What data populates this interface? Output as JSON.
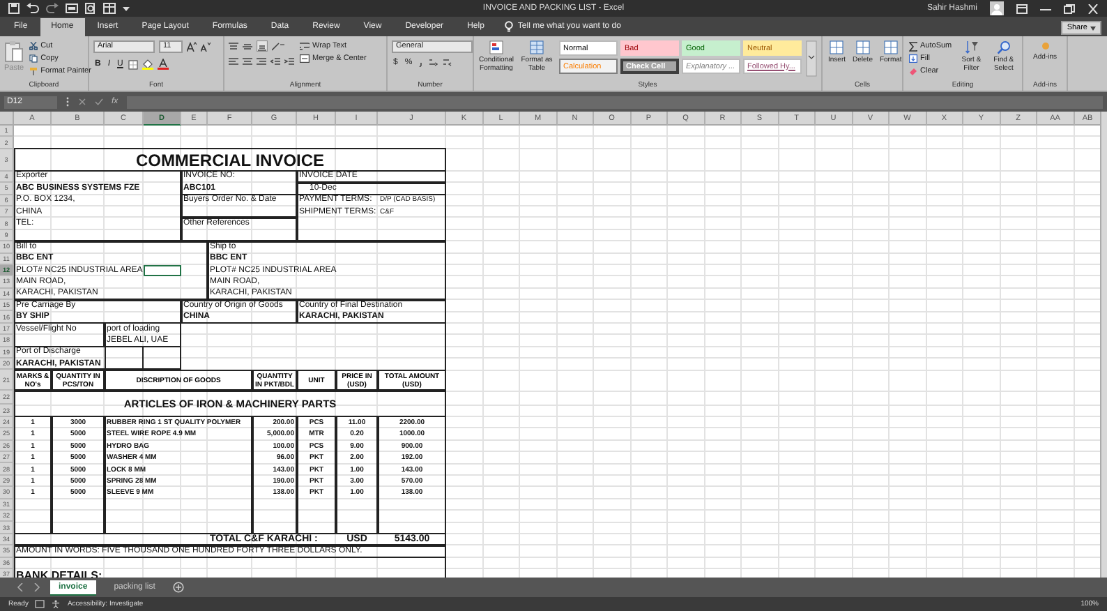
{
  "window": {
    "title": "INVOICE AND PACKING LIST - Excel",
    "user": "Sahir Hashmi"
  },
  "tabs": [
    {
      "label": "File",
      "selected": false
    },
    {
      "label": "Home",
      "selected": true
    },
    {
      "label": "Insert",
      "selected": false
    },
    {
      "label": "Page Layout",
      "selected": false
    },
    {
      "label": "Formulas",
      "selected": false
    },
    {
      "label": "Data",
      "selected": false
    },
    {
      "label": "Review",
      "selected": false
    },
    {
      "label": "View",
      "selected": false
    },
    {
      "label": "Developer",
      "selected": false
    },
    {
      "label": "Help",
      "selected": false
    }
  ],
  "tell_me": {
    "placeholder": "Tell me what you want to do"
  },
  "share": "Share",
  "ribbon": {
    "clipboard": {
      "label": "Clipboard",
      "paste": "Paste",
      "cut": "Cut",
      "copy": "Copy",
      "format_painter": "Format Painter"
    },
    "font": {
      "label": "Font",
      "family": "Arial",
      "size": "11",
      "style_buttons": [
        "B",
        "I",
        "U"
      ]
    },
    "alignment": {
      "label": "Alignment",
      "wrap_text": "Wrap Text",
      "merge_center": "Merge & Center"
    },
    "number": {
      "label": "Number",
      "format": "General",
      "buttons": [
        "$",
        "%"
      ]
    },
    "styles": {
      "label": "Styles",
      "conditional_formatting": "Conditional Formatting",
      "format_as_table": "Format as Table",
      "cell_styles": [
        {
          "label": "Normal",
          "kind": "normal"
        },
        {
          "label": "Bad",
          "kind": "bad"
        },
        {
          "label": "Good",
          "kind": "good"
        },
        {
          "label": "Neutral",
          "kind": "neutral"
        },
        {
          "label": "Calculation",
          "kind": "calculation"
        },
        {
          "label": "Check Cell",
          "kind": "check"
        },
        {
          "label": "Explanatory ...",
          "kind": "explanatory"
        },
        {
          "label": "Followed Hy...",
          "kind": "followed_link"
        }
      ]
    },
    "cells": {
      "label": "Cells",
      "buttons": [
        "Insert",
        "Delete",
        "Format"
      ]
    },
    "editing": {
      "label": "Editing",
      "autosum": "AutoSum",
      "fill": "Fill",
      "clear": "Clear",
      "sort_filter": "Sort & Filter",
      "find_select": "Find & Select"
    },
    "addins": {
      "label": "Add-ins",
      "button": "Add-ins"
    }
  },
  "formula_bar": {
    "name_box": "D12",
    "function_label": "fx"
  },
  "sheet": {
    "columns": [
      {
        "label": "A",
        "selected": false
      },
      {
        "label": "B",
        "selected": false
      },
      {
        "label": "C",
        "selected": false
      },
      {
        "label": "D",
        "selected": true
      },
      {
        "label": "E",
        "selected": false
      },
      {
        "label": "F",
        "selected": false
      },
      {
        "label": "G",
        "selected": false
      },
      {
        "label": "H",
        "selected": false
      },
      {
        "label": "I",
        "selected": false
      },
      {
        "label": "J",
        "selected": false
      },
      {
        "label": "K",
        "selected": false
      },
      {
        "label": "L",
        "selected": false
      },
      {
        "label": "M",
        "selected": false
      },
      {
        "label": "N",
        "selected": false
      },
      {
        "label": "O",
        "selected": false
      },
      {
        "label": "P",
        "selected": false
      },
      {
        "label": "Q",
        "selected": false
      },
      {
        "label": "R",
        "selected": false
      },
      {
        "label": "S",
        "selected": false
      },
      {
        "label": "T",
        "selected": false
      },
      {
        "label": "U",
        "selected": false
      },
      {
        "label": "V",
        "selected": false
      },
      {
        "label": "W",
        "selected": false
      },
      {
        "label": "X",
        "selected": false
      },
      {
        "label": "Y",
        "selected": false
      },
      {
        "label": "Z",
        "selected": false
      },
      {
        "label": "AA",
        "selected": false
      },
      {
        "label": "AB",
        "selected": false
      }
    ],
    "rows": [
      {
        "label": "1",
        "selected": false
      },
      {
        "label": "2",
        "selected": false
      },
      {
        "label": "3",
        "selected": false
      },
      {
        "label": "4",
        "selected": false
      },
      {
        "label": "5",
        "selected": false
      },
      {
        "label": "6",
        "selected": false
      },
      {
        "label": "7",
        "selected": false
      },
      {
        "label": "8",
        "selected": false
      },
      {
        "label": "9",
        "selected": false
      },
      {
        "label": "10",
        "selected": false
      },
      {
        "label": "11",
        "selected": false
      },
      {
        "label": "12",
        "selected": true
      },
      {
        "label": "13",
        "selected": false
      },
      {
        "label": "14",
        "selected": false
      },
      {
        "label": "15",
        "selected": false
      },
      {
        "label": "16",
        "selected": false
      },
      {
        "label": "17",
        "selected": false
      },
      {
        "label": "18",
        "selected": false
      },
      {
        "label": "19",
        "selected": false
      },
      {
        "label": "20",
        "selected": false
      },
      {
        "label": "21",
        "selected": false
      },
      {
        "label": "22",
        "selected": false
      },
      {
        "label": "23",
        "selected": false
      },
      {
        "label": "24",
        "selected": false
      },
      {
        "label": "25",
        "selected": false
      },
      {
        "label": "26",
        "selected": false
      },
      {
        "label": "27",
        "selected": false
      },
      {
        "label": "28",
        "selected": false
      },
      {
        "label": "29",
        "selected": false
      },
      {
        "label": "30",
        "selected": false
      },
      {
        "label": "31",
        "selected": false
      },
      {
        "label": "32",
        "selected": false
      },
      {
        "label": "33",
        "selected": false
      },
      {
        "label": "34",
        "selected": false
      },
      {
        "label": "35",
        "selected": false
      },
      {
        "label": "36",
        "selected": false
      },
      {
        "label": "37",
        "selected": false
      }
    ]
  },
  "invoice": {
    "title": "COMMERCIAL INVOICE",
    "exporter": {
      "label": "Exporter",
      "name": "ABC BUSINESS SYSTEMS FZE",
      "lines": [
        "P.O. BOX 1234,",
        "CHINA",
        "TEL:"
      ]
    },
    "invoice_no": {
      "label": "INVOICE NO:",
      "value": "ABC101"
    },
    "invoice_date": {
      "label": "INVOICE DATE",
      "value": "10-Dec"
    },
    "buyers_order": "Buyers Order No. & Date",
    "other_references": "Other References",
    "payment_terms": {
      "label": "PAYMENT TERMS:",
      "value": "D/P (CAD BASIS)"
    },
    "shipment_terms": {
      "label": "SHIPMENT TERMS:",
      "value": "C&F"
    },
    "bill_to": {
      "label": "Bill to",
      "name": "BBC ENT",
      "lines": [
        "PLOT# NC25 INDUSTRIAL AREA",
        "MAIN ROAD,",
        "KARACHI, PAKISTAN"
      ]
    },
    "ship_to": {
      "label": "Ship to",
      "name": "BBC ENT",
      "lines": [
        "PLOT# NC25 INDUSTRIAL AREA",
        "MAIN ROAD,",
        "KARACHI, PAKISTAN"
      ]
    },
    "pre_carriage": {
      "label": "Pre Carriage By",
      "value": "BY SHIP"
    },
    "country_origin": {
      "label": "Country of Origin of Goods",
      "value": "CHINA"
    },
    "country_destination": {
      "label": "Country of Final Destination",
      "value": "KARACHI, PAKISTAN"
    },
    "vessel": {
      "label": "Vessel/Flight No"
    },
    "port_loading": {
      "label": "port of loading",
      "value": "JEBEL ALI, UAE"
    },
    "port_discharge": {
      "label": "Port of Discharge",
      "value": "KARACHI, PAKISTAN"
    },
    "items": {
      "columns": [
        "MARKS & NO's",
        "QUANTITY IN PCS/TON",
        "DISCRIPTION OF GOODS",
        "QUANTITY IN PKT/BDL",
        "UNIT",
        "PRICE IN (USD)",
        "TOTAL AMOUNT (USD)"
      ],
      "heading": "ARTICLES OF IRON & MACHINERY PARTS",
      "rows": [
        {
          "marks": "1",
          "quantity": "3000",
          "description": "RUBBER RING 1 ST QUALITY POLYMER",
          "quantity_pkt": "200.00",
          "unit": "PCS",
          "price": "11.00",
          "total": "2200.00"
        },
        {
          "marks": "1",
          "quantity": "5000",
          "description": "STEEL WIRE ROPE 4.9 MM",
          "quantity_pkt": "5,000.00",
          "unit": "MTR",
          "price": "0.20",
          "total": "1000.00"
        },
        {
          "marks": "1",
          "quantity": "5000",
          "description": "HYDRO BAG",
          "quantity_pkt": "100.00",
          "unit": "PCS",
          "price": "9.00",
          "total": "900.00"
        },
        {
          "marks": "1",
          "quantity": "5000",
          "description": "WASHER 4 MM",
          "quantity_pkt": "96.00",
          "unit": "PKT",
          "price": "2.00",
          "total": "192.00"
        },
        {
          "marks": "1",
          "quantity": "5000",
          "description": "LOCK 8 MM",
          "quantity_pkt": "143.00",
          "unit": "PKT",
          "price": "1.00",
          "total": "143.00"
        },
        {
          "marks": "1",
          "quantity": "5000",
          "description": "SPRING 28 MM",
          "quantity_pkt": "190.00",
          "unit": "PKT",
          "price": "3.00",
          "total": "570.00"
        },
        {
          "marks": "1",
          "quantity": "5000",
          "description": "SLEEVE 9 MM",
          "quantity_pkt": "138.00",
          "unit": "PKT",
          "price": "1.00",
          "total": "138.00"
        }
      ]
    },
    "total": {
      "label": "TOTAL C&F KARACHI :",
      "currency": "USD",
      "amount": "5143.00"
    },
    "amount_in_words": "AMOUNT IN WORDS:  FIVE THOUSAND ONE HUNDRED FORTY THREE DOLLARS ONLY.",
    "bank_details": "BANK DETAILS:"
  },
  "sheet_tabs": [
    {
      "label": "invoice",
      "selected": true
    },
    {
      "label": "packing list",
      "selected": false
    }
  ],
  "status_bar": {
    "mode": "Ready",
    "accessibility": "Accessibility: Investigate",
    "zoom": "100%"
  }
}
